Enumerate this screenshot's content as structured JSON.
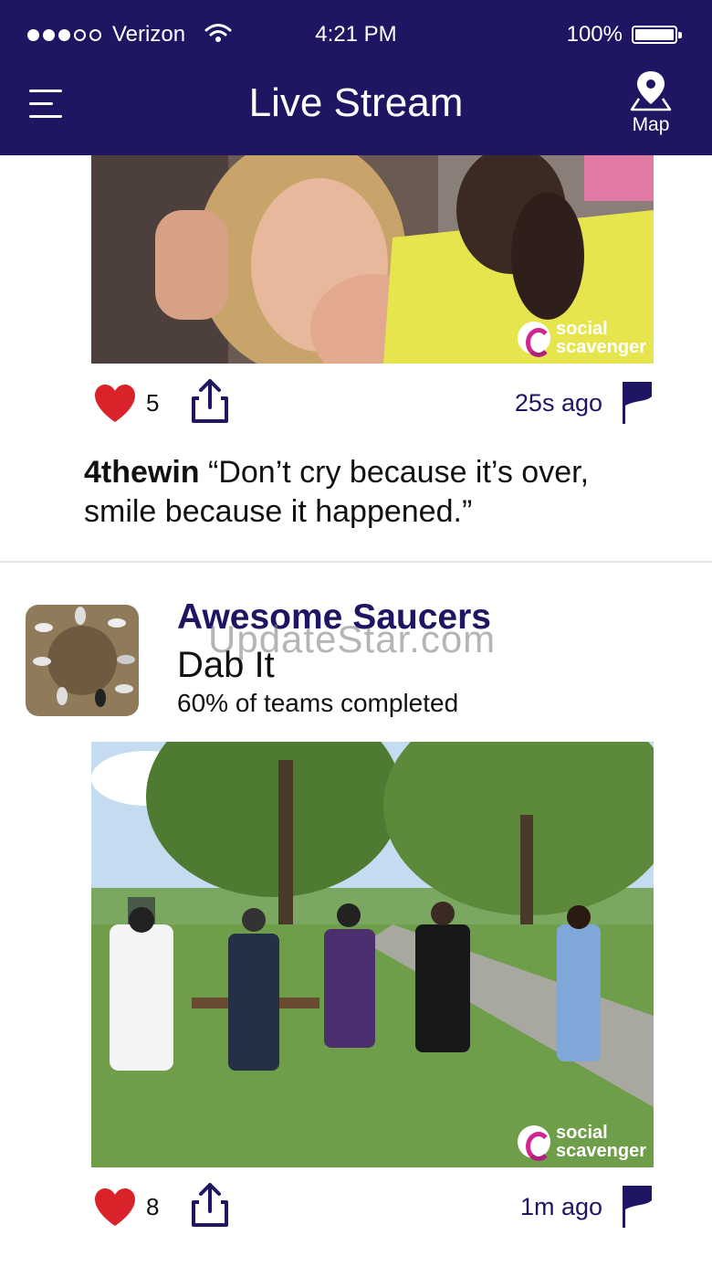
{
  "status_bar": {
    "carrier": "Verizon",
    "time": "4:21 PM",
    "battery": "100%"
  },
  "header": {
    "title": "Live Stream",
    "map_label": "Map"
  },
  "colors": {
    "brand": "#1e1663",
    "heart": "#d9222a",
    "watermark_accent": "#d2268f"
  },
  "posts": [
    {
      "likes": "5",
      "time_ago": "25s ago",
      "team": "4thewin",
      "caption": " “Don’t cry because it’s over, smile because it happened.”",
      "photo_watermark": [
        "social",
        "scavenger"
      ]
    },
    {
      "team": "Awesome Saucers",
      "challenge": "Dab It",
      "progress": "60% of teams completed",
      "likes": "8",
      "time_ago": "1m ago",
      "photo_watermark": [
        "social",
        "scavenger"
      ]
    }
  ],
  "overlay_watermark": "UpdateStar.com"
}
